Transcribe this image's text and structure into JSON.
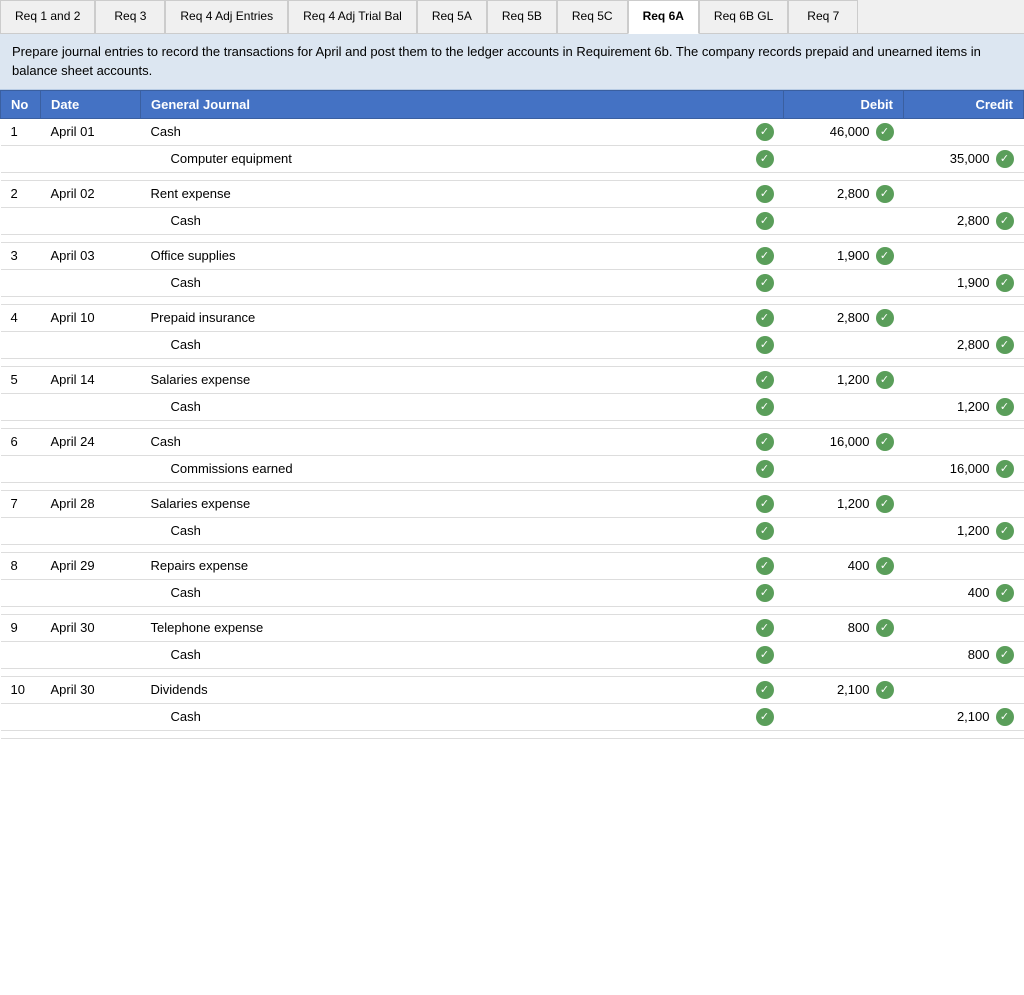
{
  "tabs": [
    {
      "label": "Req 1 and 2",
      "active": false
    },
    {
      "label": "Req 3",
      "active": false
    },
    {
      "label": "Req 4 Adj\nEntries",
      "active": false
    },
    {
      "label": "Req 4 Adj\nTrial Bal",
      "active": false
    },
    {
      "label": "Req 5A",
      "active": false
    },
    {
      "label": "Req 5B",
      "active": false
    },
    {
      "label": "Req 5C",
      "active": false
    },
    {
      "label": "Req 6A",
      "active": true
    },
    {
      "label": "Req 6B GL",
      "active": false
    },
    {
      "label": "Req 7",
      "active": false
    }
  ],
  "instruction": "Prepare journal entries to record the transactions for April and post them to the ledger accounts in Requirement 6b. The company records prepaid and unearned items in balance sheet accounts.",
  "columns": {
    "no": "No",
    "date": "Date",
    "journal": "General Journal",
    "debit": "Debit",
    "credit": "Credit"
  },
  "entries": [
    {
      "no": "1",
      "date": "April 01",
      "debit_line": {
        "account": "Cash",
        "amount": "46,000"
      },
      "credit_line": {
        "account": "Computer equipment",
        "amount": "35,000"
      }
    },
    {
      "no": "2",
      "date": "April 02",
      "debit_line": {
        "account": "Rent expense",
        "amount": "2,800"
      },
      "credit_line": {
        "account": "Cash",
        "amount": "2,800"
      }
    },
    {
      "no": "3",
      "date": "April 03",
      "debit_line": {
        "account": "Office supplies",
        "amount": "1,900"
      },
      "credit_line": {
        "account": "Cash",
        "amount": "1,900"
      }
    },
    {
      "no": "4",
      "date": "April 10",
      "debit_line": {
        "account": "Prepaid insurance",
        "amount": "2,800"
      },
      "credit_line": {
        "account": "Cash",
        "amount": "2,800"
      }
    },
    {
      "no": "5",
      "date": "April 14",
      "debit_line": {
        "account": "Salaries expense",
        "amount": "1,200"
      },
      "credit_line": {
        "account": "Cash",
        "amount": "1,200"
      }
    },
    {
      "no": "6",
      "date": "April 24",
      "debit_line": {
        "account": "Cash",
        "amount": "16,000"
      },
      "credit_line": {
        "account": "Commissions earned",
        "amount": "16,000"
      }
    },
    {
      "no": "7",
      "date": "April 28",
      "debit_line": {
        "account": "Salaries expense",
        "amount": "1,200"
      },
      "credit_line": {
        "account": "Cash",
        "amount": "1,200"
      }
    },
    {
      "no": "8",
      "date": "April 29",
      "debit_line": {
        "account": "Repairs expense",
        "amount": "400"
      },
      "credit_line": {
        "account": "Cash",
        "amount": "400"
      }
    },
    {
      "no": "9",
      "date": "April 30",
      "debit_line": {
        "account": "Telephone expense",
        "amount": "800"
      },
      "credit_line": {
        "account": "Cash",
        "amount": "800"
      }
    },
    {
      "no": "10",
      "date": "April 30",
      "debit_line": {
        "account": "Dividends",
        "amount": "2,100"
      },
      "credit_line": {
        "account": "Cash",
        "amount": "2,100"
      }
    }
  ]
}
